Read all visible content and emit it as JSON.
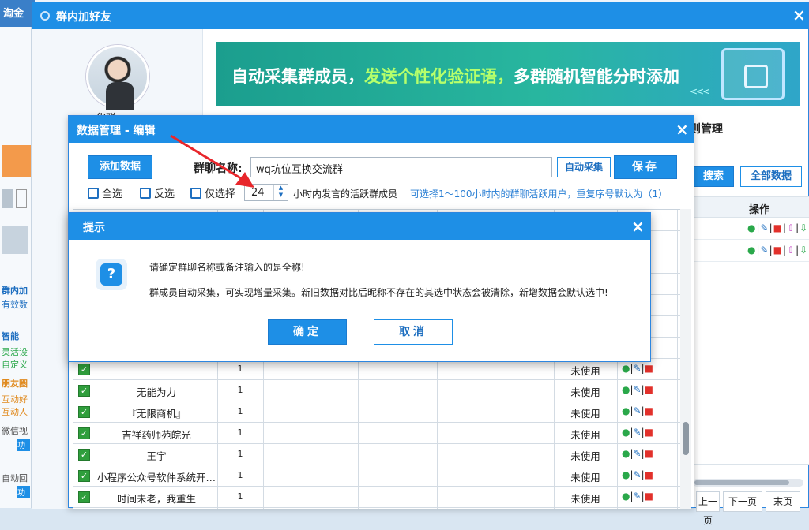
{
  "bg_app": {
    "title": "淘金",
    "side_items": [
      "群内加",
      "有效数",
      "智能",
      "灵活设",
      "自定义",
      "朋友圈",
      "互动好",
      "互动人",
      "微信视",
      "功",
      "自动回",
      "功"
    ],
    "axis_ticks": [
      "1",
      "1",
      "1",
      "0",
      "0"
    ]
  },
  "main_window": {
    "title": "群内加好友",
    "close": "×",
    "user_name": "化聪",
    "banner": {
      "part1": "自动采集群成员，",
      "part2": "发送个性化验证语，",
      "part3": "多群随机智能分时添加",
      "chevrons": "<<<"
    },
    "rule_mgmt_label": "则管理",
    "search_button": "搜索",
    "all_data_button": "全部数据",
    "table_header_ops": "操作",
    "pager": {
      "prev": "上一页",
      "next": "下一页",
      "last": "末页"
    }
  },
  "data_dialog": {
    "title": "数据管理 - 编辑",
    "close": "×",
    "add_button": "添加数据",
    "group_name_label": "群聊名称:",
    "group_name_value": "wq坑位互换交流群",
    "auto_collect_button": "自动采集",
    "save_button": "保存",
    "select_all": "全选",
    "invert_select": "反选",
    "only_select": "仅选择",
    "hours_value": "24",
    "hint_active": "小时内发言的活跃群成员",
    "hint_range": "可选择1～100小时内的群聊活跃用户，重复序号默认为（1）",
    "rows": [
      {
        "name": "",
        "num": "1",
        "status": "未使用"
      },
      {
        "name": "无能为力",
        "num": "1",
        "status": "未使用"
      },
      {
        "name": "『无限商机』",
        "num": "1",
        "status": "未使用"
      },
      {
        "name": "吉祥药师苑皖光",
        "num": "1",
        "status": "未使用"
      },
      {
        "name": "王宇",
        "num": "1",
        "status": "未使用"
      },
      {
        "name": "小程序公众号软件系统开…",
        "num": "1",
        "status": "未使用"
      },
      {
        "name": "时间未老，我重生",
        "num": "1",
        "status": "未使用"
      }
    ]
  },
  "alert": {
    "title": "提示",
    "close": "×",
    "icon": "question-icon",
    "line1": "请确定群聊名称或备注输入的是全称!",
    "line2": "群成员自动采集，可实现增量采集。新旧数据对比后昵称不存在的其选中状态会被清除，新增数据会默认选中!",
    "ok_button": "确定",
    "cancel_button": "取消"
  },
  "colors": {
    "title_bar": "#1e8fe6",
    "check": "#2f9e3c",
    "delete": "#e2312b",
    "arrow": "#e8262b"
  }
}
